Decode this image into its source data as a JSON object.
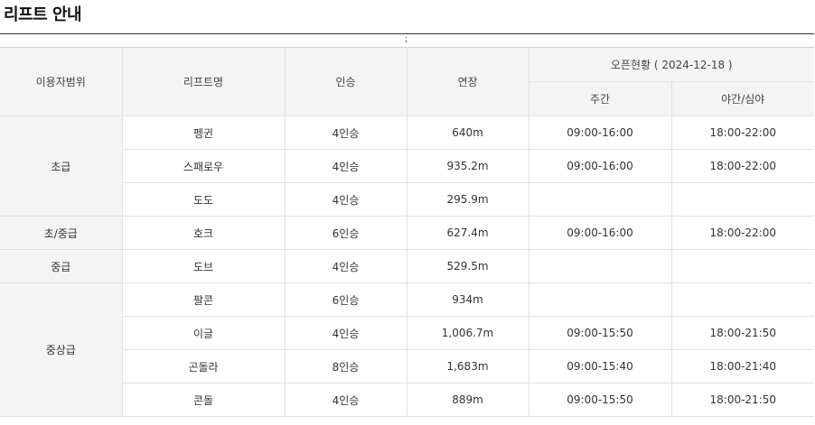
{
  "page": {
    "title": "리프트 안내",
    "separator_mark": ";"
  },
  "table": {
    "headers": {
      "user_range": "이용자범위",
      "lift_name": "리프트명",
      "capacity": "인승",
      "length": "연장",
      "open_status": "오픈현황 ( 2024-12-18 )",
      "day": "주간",
      "night": "야간/심야"
    },
    "groups": [
      {
        "category": "초급",
        "lifts": [
          {
            "name": "펭귄",
            "capacity": "4인승",
            "length": "640m",
            "day": "09:00-16:00",
            "night": "18:00-22:00"
          },
          {
            "name": "스패로우",
            "capacity": "4인승",
            "length": "935.2m",
            "day": "09:00-16:00",
            "night": "18:00-22:00"
          },
          {
            "name": "도도",
            "capacity": "4인승",
            "length": "295.9m",
            "day": "",
            "night": ""
          }
        ]
      },
      {
        "category": "초/중급",
        "lifts": [
          {
            "name": "호크",
            "capacity": "6인승",
            "length": "627.4m",
            "day": "09:00-16:00",
            "night": "18:00-22:00"
          }
        ]
      },
      {
        "category": "중급",
        "lifts": [
          {
            "name": "도브",
            "capacity": "4인승",
            "length": "529.5m",
            "day": "",
            "night": ""
          }
        ]
      },
      {
        "category": "중상급",
        "lifts": [
          {
            "name": "팔콘",
            "capacity": "6인승",
            "length": "934m",
            "day": "",
            "night": ""
          },
          {
            "name": "이글",
            "capacity": "4인승",
            "length": "1,006.7m",
            "day": "09:00-15:50",
            "night": "18:00-21:50"
          },
          {
            "name": "곤돌라",
            "capacity": "8인승",
            "length": "1,683m",
            "day": "09:00-15:40",
            "night": "18:00-21:40"
          },
          {
            "name": "콘돌",
            "capacity": "4인승",
            "length": "889m",
            "day": "09:00-15:50",
            "night": "18:00-21:50"
          }
        ]
      }
    ]
  },
  "colors": {
    "day_time": "#c9531b",
    "night_time": "#1e2e4a",
    "header_bg": "#f4f4f4"
  }
}
